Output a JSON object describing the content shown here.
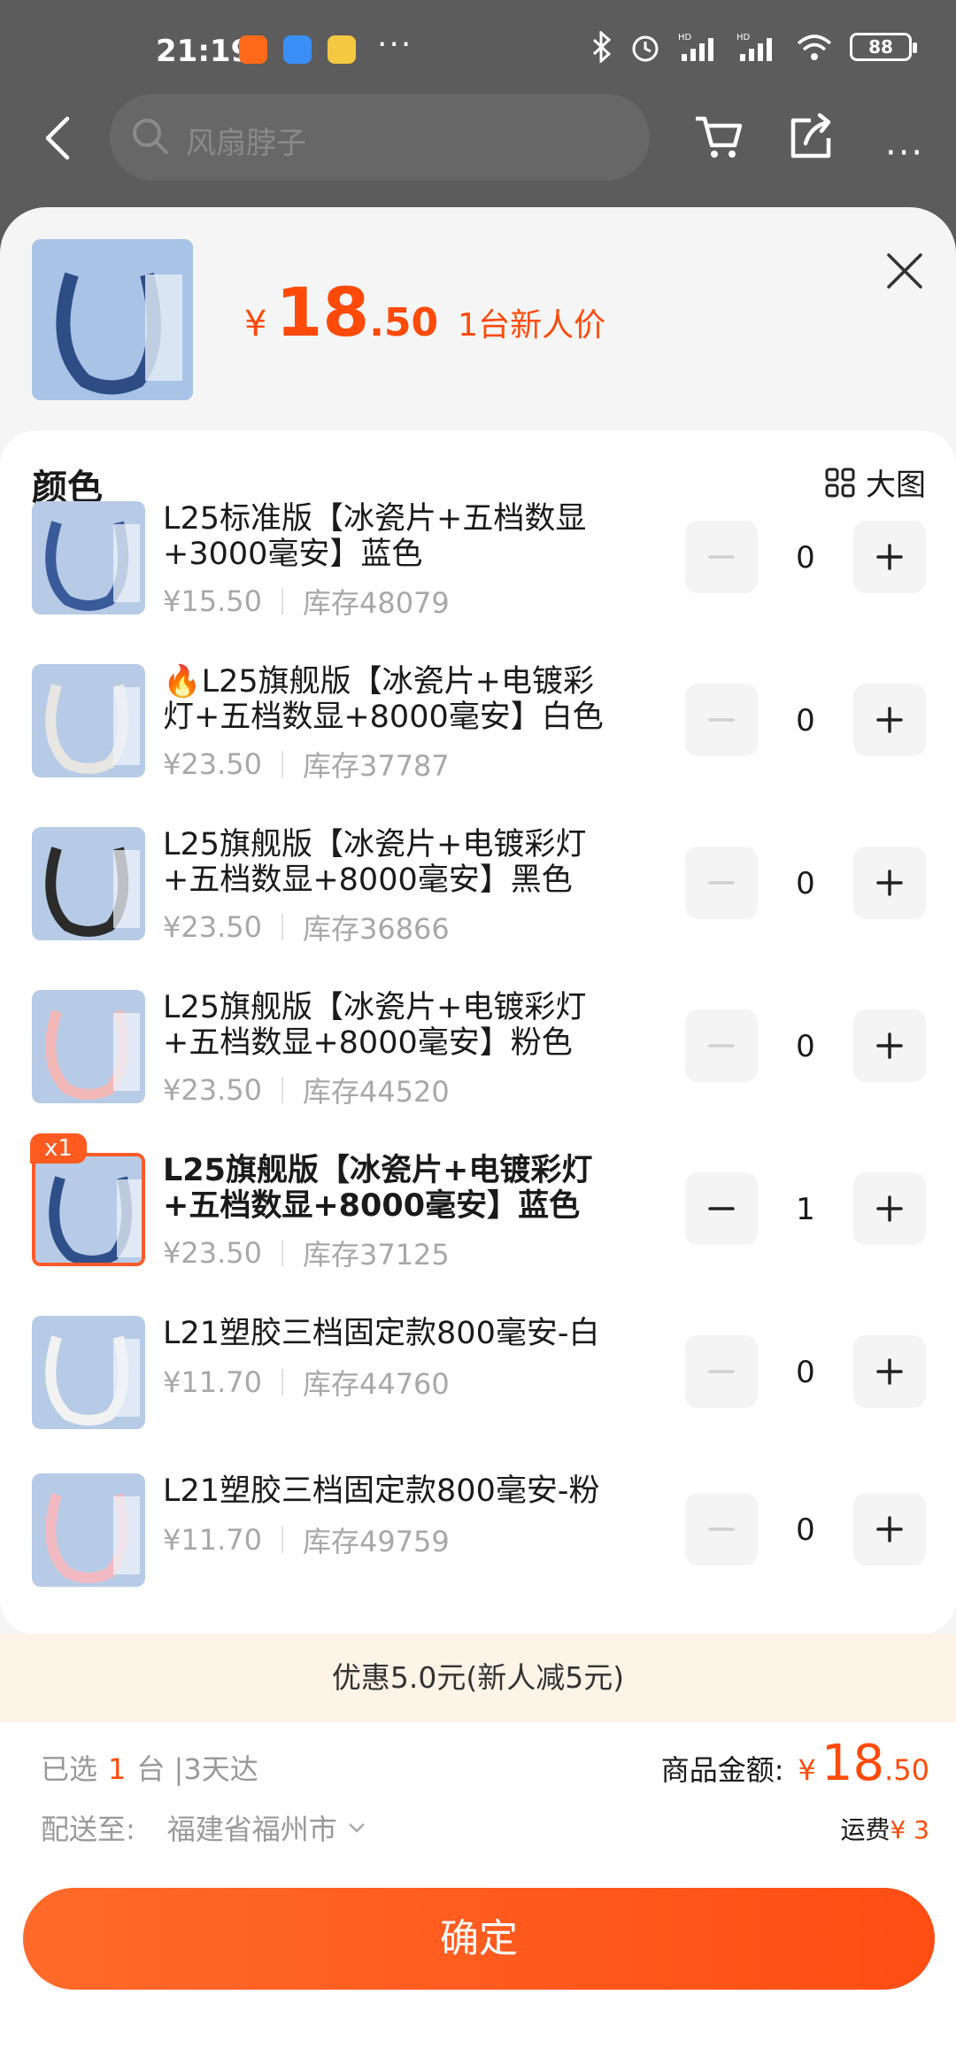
{
  "status_bar": {
    "time": "21:19",
    "dots": "···",
    "battery": "88",
    "network_1": "HD",
    "network_2": "HD"
  },
  "nav": {
    "search_placeholder": "风扇脖子"
  },
  "header": {
    "currency": "¥",
    "price_int": "18",
    "price_dec": ".50",
    "price_tag": "1台新人价"
  },
  "variants": {
    "title": "颜色",
    "big_view": "大图",
    "items": [
      {
        "name": "L25标准版【冰瓷片+五档数显+3000毫安】蓝色",
        "price": "¥15.50",
        "stock": "库存48079",
        "qty": "0",
        "theme": "#3a5a9a"
      },
      {
        "name": "🔥L25旗舰版【冰瓷片+电镀彩灯+五档数显+8000毫安】白色",
        "price": "¥23.50",
        "stock": "库存37787",
        "qty": "0",
        "theme": "#e8e6e2"
      },
      {
        "name": "L25旗舰版【冰瓷片+电镀彩灯+五档数显+8000毫安】黑色",
        "price": "¥23.50",
        "stock": "库存36866",
        "qty": "0",
        "theme": "#2b2b2b"
      },
      {
        "name": "L25旗舰版【冰瓷片+电镀彩灯+五档数显+8000毫安】粉色",
        "price": "¥23.50",
        "stock": "库存44520",
        "qty": "0",
        "theme": "#f2b8b8"
      },
      {
        "name": "L25旗舰版【冰瓷片+电镀彩灯+五档数显+8000毫安】蓝色",
        "price": "¥23.50",
        "stock": "库存37125",
        "qty": "1",
        "theme": "#2f4f8a",
        "badge": "x1"
      },
      {
        "name": "L21塑胶三档固定款800毫安-白",
        "price": "¥11.70",
        "stock": "库存44760",
        "qty": "0",
        "theme": "#f2f2f2"
      },
      {
        "name": "L21塑胶三档固定款800毫安-粉",
        "price": "¥11.70",
        "stock": "库存49759",
        "qty": "0",
        "theme": "#f3b9c2"
      }
    ]
  },
  "promo": "优惠5.0元(新人减5元)",
  "summary": {
    "selected_prefix": "已选",
    "selected_count": "1",
    "selected_suffix": "台 |3天达",
    "amount_label": "商品金额:",
    "amount_currency": "¥",
    "amount_int": "18",
    "amount_dec": ".50",
    "ship_label": "配送至:",
    "ship_city": "福建省福州市",
    "freight_label": "运费",
    "freight_value": "¥ 3",
    "confirm": "确定"
  },
  "colors": {
    "accent": "#ff4a0a",
    "button": "#ff5a1f",
    "overlay": "#5c5c5c"
  }
}
